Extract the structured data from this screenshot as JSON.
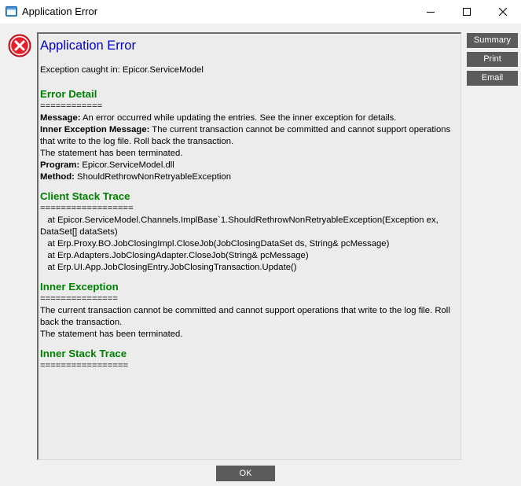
{
  "window": {
    "title": "Application Error",
    "icon": "app-window-icon"
  },
  "side_buttons": {
    "summary": "Summary",
    "print": "Print",
    "email": "Email"
  },
  "ok_label": "OK",
  "report": {
    "title": "Application Error",
    "caught_in": "Exception caught in: Epicor.ServiceModel",
    "error_detail": {
      "heading": "Error Detail",
      "rule": "============",
      "message_label": "Message:",
      "message_value": " An error occurred while updating the entries. See the inner exception for details.",
      "inner_label": "Inner Exception Message:",
      "inner_value": " The current transaction cannot be committed and cannot support operations that write to the log file. Roll back the transaction.",
      "terminated": "The statement has been terminated.",
      "program_label": "Program:",
      "program_value": " Epicor.ServiceModel.dll",
      "method_label": "Method:",
      "method_value": " ShouldRethrowNonRetryableException"
    },
    "client_stack": {
      "heading": "Client Stack Trace",
      "rule": "==================",
      "lines": [
        "   at Epicor.ServiceModel.Channels.ImplBase`1.ShouldRethrowNonRetryableException(Exception ex, DataSet[] dataSets)",
        "   at Erp.Proxy.BO.JobClosingImpl.CloseJob(JobClosingDataSet ds, String& pcMessage)",
        "   at Erp.Adapters.JobClosingAdapter.CloseJob(String& pcMessage)",
        "   at Erp.UI.App.JobClosingEntry.JobClosingTransaction.Update()"
      ]
    },
    "inner_exception": {
      "heading": "Inner Exception",
      "rule": "===============",
      "text": "The current transaction cannot be committed and cannot support operations that write to the log file. Roll back the transaction.",
      "terminated": "The statement has been terminated."
    },
    "inner_stack": {
      "heading": "Inner Stack Trace",
      "rule": "================="
    }
  },
  "colors": {
    "title_blue": "#0000cc",
    "section_green": "#008000",
    "button_gray": "#5b5b5b",
    "error_red": "#e3202b"
  }
}
